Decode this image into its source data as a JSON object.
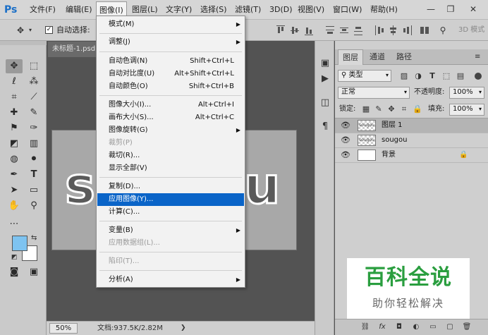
{
  "app": {
    "logo": "Ps"
  },
  "menubar": {
    "items": [
      "文件(F)",
      "编辑(E)",
      "图像(I)",
      "图层(L)",
      "文字(Y)",
      "选择(S)",
      "滤镜(T)",
      "3D(D)",
      "视图(V)",
      "窗口(W)",
      "帮助(H)"
    ],
    "active_index": 2
  },
  "window_controls": {
    "minimize": "—",
    "maximize": "❐",
    "close": "✕"
  },
  "options_bar": {
    "auto_select_label": "自动选择:",
    "mode_3d_label": "3D 模式"
  },
  "document": {
    "tab_title": "未标题-1.psd",
    "canvas_text": "sougou"
  },
  "status_bar": {
    "zoom": "50%",
    "doc_info": "文档:937.5K/2.82M",
    "arrow": "❯"
  },
  "image_menu": {
    "items": [
      {
        "label": "模式(M)",
        "shortcut": "",
        "submenu": true,
        "disabled": false
      },
      {
        "label": "调整(J)",
        "shortcut": "",
        "submenu": true,
        "disabled": false
      },
      {
        "label": "自动色调(N)",
        "shortcut": "Shift+Ctrl+L",
        "submenu": false,
        "disabled": false
      },
      {
        "label": "自动对比度(U)",
        "shortcut": "Alt+Shift+Ctrl+L",
        "submenu": false,
        "disabled": false
      },
      {
        "label": "自动颜色(O)",
        "shortcut": "Shift+Ctrl+B",
        "submenu": false,
        "disabled": false
      },
      {
        "label": "图像大小(I)...",
        "shortcut": "Alt+Ctrl+I",
        "submenu": false,
        "disabled": false
      },
      {
        "label": "画布大小(S)...",
        "shortcut": "Alt+Ctrl+C",
        "submenu": false,
        "disabled": false
      },
      {
        "label": "图像旋转(G)",
        "shortcut": "",
        "submenu": true,
        "disabled": false
      },
      {
        "label": "裁剪(P)",
        "shortcut": "",
        "submenu": false,
        "disabled": true
      },
      {
        "label": "裁切(R)...",
        "shortcut": "",
        "submenu": false,
        "disabled": false
      },
      {
        "label": "显示全部(V)",
        "shortcut": "",
        "submenu": false,
        "disabled": false
      },
      {
        "label": "复制(D)...",
        "shortcut": "",
        "submenu": false,
        "disabled": false
      },
      {
        "label": "应用图像(Y)...",
        "shortcut": "",
        "submenu": false,
        "disabled": false,
        "highlighted": true
      },
      {
        "label": "计算(C)...",
        "shortcut": "",
        "submenu": false,
        "disabled": false
      },
      {
        "label": "变量(B)",
        "shortcut": "",
        "submenu": true,
        "disabled": false
      },
      {
        "label": "应用数据组(L)...",
        "shortcut": "",
        "submenu": false,
        "disabled": true
      },
      {
        "label": "陷印(T)...",
        "shortcut": "",
        "submenu": false,
        "disabled": true
      },
      {
        "label": "分析(A)",
        "shortcut": "",
        "submenu": true,
        "disabled": false
      }
    ]
  },
  "layers_panel": {
    "tabs": [
      "图层",
      "通道",
      "路径"
    ],
    "active_tab": 0,
    "filter_kind": "类型",
    "blend_mode": "正常",
    "opacity_label": "不透明度:",
    "opacity_value": "100%",
    "lock_label": "锁定:",
    "fill_label": "填充:",
    "fill_value": "100%",
    "layers": [
      {
        "name": "图层 1",
        "thumb": "sougou",
        "selected": true,
        "locked": false
      },
      {
        "name": "sougou",
        "thumb": "sougou",
        "selected": false,
        "locked": false
      },
      {
        "name": "背景",
        "thumb": "",
        "selected": false,
        "locked": true
      }
    ]
  },
  "watermark": {
    "title": "百科全说",
    "subtitle": "助你轻松解决"
  },
  "panel_footer": {
    "fx_label": "fx"
  }
}
